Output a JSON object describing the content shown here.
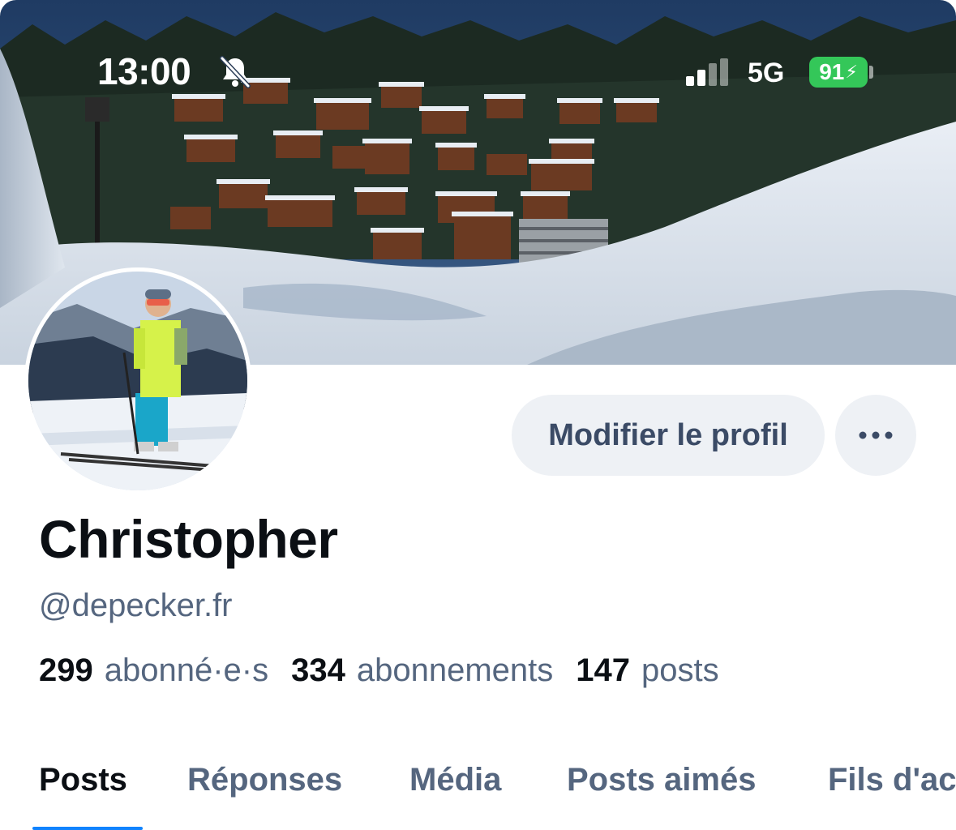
{
  "status_bar": {
    "time": "13:00",
    "mute_icon": "bell-slash-icon",
    "signal_icon": "cellular-signal-icon",
    "network": "5G",
    "battery_level": "91",
    "battery_charging": true,
    "battery_color": "#34c759"
  },
  "banner": {
    "image": "snowy-alpine-village-banner"
  },
  "avatar": {
    "image": "skier-profile-photo"
  },
  "actions": {
    "edit_profile_label": "Modifier le profil",
    "more_icon": "ellipsis-icon"
  },
  "profile": {
    "display_name": "Christopher",
    "handle": "@depecker.fr"
  },
  "stats": [
    {
      "value": "299",
      "label": "abonné·e·s"
    },
    {
      "value": "334",
      "label": "abonnements"
    },
    {
      "value": "147",
      "label": "posts"
    }
  ],
  "tabs": [
    {
      "label": "Posts",
      "active": true
    },
    {
      "label": "Réponses",
      "active": false
    },
    {
      "label": "Média",
      "active": false
    },
    {
      "label": "Posts aimés",
      "active": false
    },
    {
      "label": "Fils d'ac",
      "active": false
    }
  ],
  "colors": {
    "accent": "#1083fe",
    "text_primary": "#0b0f14",
    "text_secondary": "#55667f",
    "button_bg": "#eef1f5"
  }
}
